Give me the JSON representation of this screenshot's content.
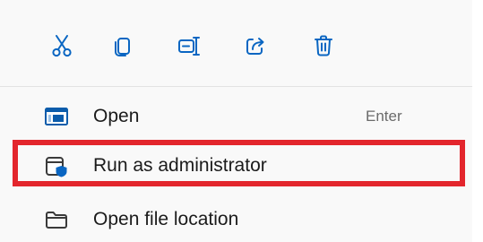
{
  "toolbar": {
    "buttons": [
      {
        "name": "cut",
        "icon": "scissors-icon"
      },
      {
        "name": "copy",
        "icon": "copy-icon"
      },
      {
        "name": "rename",
        "icon": "rename-icon"
      },
      {
        "name": "share",
        "icon": "share-icon"
      },
      {
        "name": "delete",
        "icon": "trash-icon"
      }
    ]
  },
  "menu": {
    "items": [
      {
        "label": "Open",
        "shortcut": "Enter",
        "icon": "window-icon"
      },
      {
        "label": "Run as administrator",
        "shortcut": "",
        "icon": "shield-window-icon"
      },
      {
        "label": "Open file location",
        "shortcut": "",
        "icon": "folder-icon"
      }
    ]
  },
  "colors": {
    "accent": "#0a66c2",
    "highlight": "#e3262d",
    "menu_background": "#f9f9f9",
    "text": "#1b1b1b",
    "shortcut_text": "#6b6b6b"
  }
}
